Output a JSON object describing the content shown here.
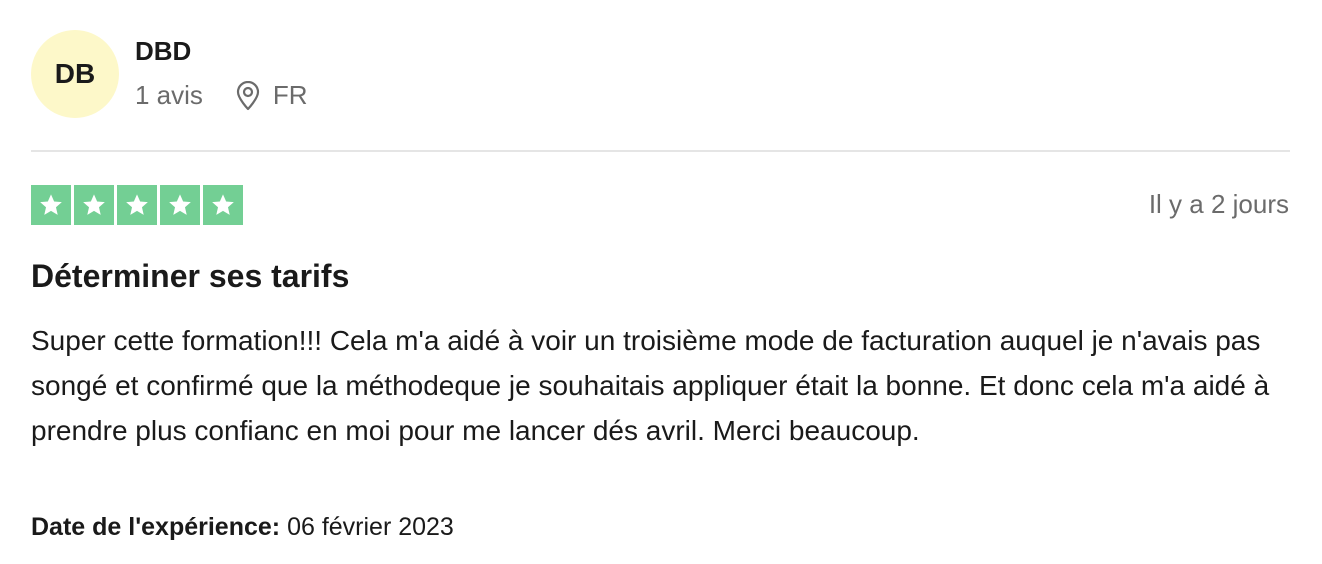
{
  "reviewer": {
    "initials": "DB",
    "name": "DBD",
    "review_count": "1 avis",
    "country": "FR",
    "location_icon": "map-pin-icon",
    "avatar_color": "#fdf8c9"
  },
  "review": {
    "rating": 5,
    "rating_max": 5,
    "star_color": "#73cf94",
    "relative_date": "Il y a 2 jours",
    "title": "Déterminer ses tarifs",
    "body": "Super cette formation!!! Cela m'a aidé à voir un troisième mode de facturation auquel je n'avais pas songé et confirmé que la méthodeque je souhaitais appliquer était la bonne. Et donc cela m'a aidé à prendre plus confianc en moi pour me lancer dés avril. Merci beaucoup.",
    "experience_label": "Date de l'expérience:",
    "experience_date": "06 février 2023"
  }
}
